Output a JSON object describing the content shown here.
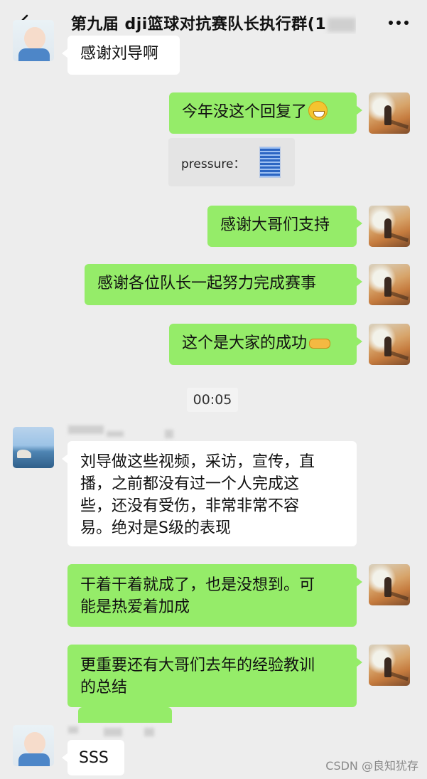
{
  "header": {
    "title": "第九届 dji篮球对抗赛队长执行群(1",
    "back_icon": "chevron-left-icon",
    "more_icon": "more-dots-icon"
  },
  "messages": [
    {
      "side": "left",
      "text": "感谢刘导啊"
    },
    {
      "side": "right",
      "text": "今年没这个回复了",
      "emoji": "grinning-face-icon"
    },
    {
      "side": "right",
      "quote": "pressure："
    },
    {
      "side": "right",
      "text": "感谢大哥们支持"
    },
    {
      "side": "right",
      "text": "感谢各位队长一起努力完成赛事"
    },
    {
      "side": "right",
      "text": "这个是大家的成功",
      "emoji": "handshake-icon"
    },
    {
      "side": "left",
      "lines": [
        "刘导做这些视频，采访，宣传，直",
        "播，之前都没有过一个人完成这",
        "些，还没有受伤，非常非常不容",
        "易。绝对是S级的表现"
      ]
    },
    {
      "side": "right",
      "lines": [
        "干着干着就成了，也是没想到。可",
        "能是热爱着加成"
      ]
    },
    {
      "side": "right",
      "lines": [
        "更重要还有大哥们去年的经验教训",
        "的总结"
      ]
    },
    {
      "side": "left",
      "text": "SSS"
    }
  ],
  "timestamp": "00:05",
  "watermark": "CSDN @良知犹存"
}
